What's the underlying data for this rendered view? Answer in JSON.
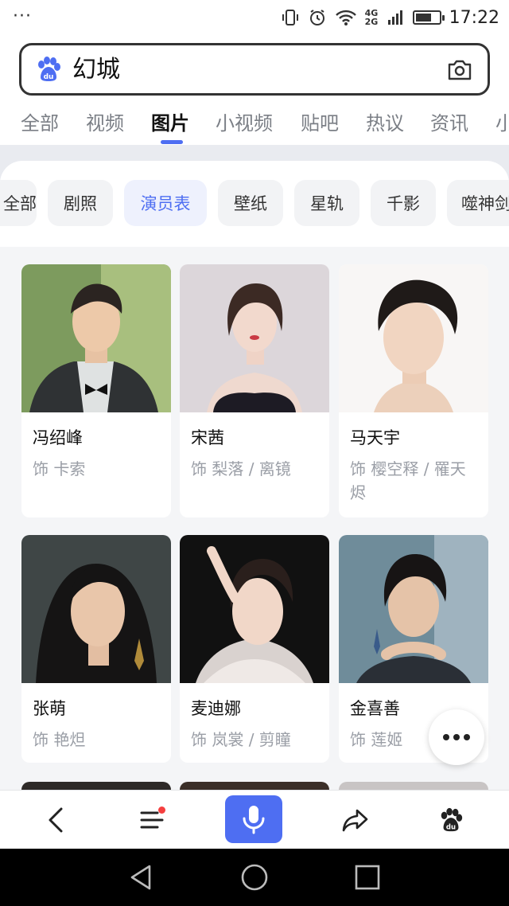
{
  "status_bar": {
    "dots": "···",
    "network": "4G 2G",
    "time": "17:22",
    "battery_level": 0.7
  },
  "search": {
    "query": "幻城",
    "icon_left": "baidu-paw-icon",
    "icon_right": "camera-icon"
  },
  "tabs": [
    {
      "label": "全部",
      "active": false
    },
    {
      "label": "视频",
      "active": false
    },
    {
      "label": "图片",
      "active": true
    },
    {
      "label": "小视频",
      "active": false
    },
    {
      "label": "贴吧",
      "active": false
    },
    {
      "label": "热议",
      "active": false
    },
    {
      "label": "资讯",
      "active": false
    },
    {
      "label": "小",
      "active": false
    }
  ],
  "chips": [
    {
      "label": "全部",
      "active": false
    },
    {
      "label": "剧照",
      "active": false
    },
    {
      "label": "演员表",
      "active": true
    },
    {
      "label": "壁纸",
      "active": false
    },
    {
      "label": "星轨",
      "active": false
    },
    {
      "label": "千影",
      "active": false
    },
    {
      "label": "噬神剑",
      "active": false
    }
  ],
  "cast": [
    {
      "name": "冯绍峰",
      "role": "饰 卡索"
    },
    {
      "name": "宋茜",
      "role": "饰 梨落 / 离镜"
    },
    {
      "name": "马天宇",
      "role": "饰 樱空释 / 罹天烬"
    },
    {
      "name": "张萌",
      "role": "饰 艳炟"
    },
    {
      "name": "麦迪娜",
      "role": "饰 岚裳 / 剪瞳"
    },
    {
      "name": "金喜善",
      "role": "饰 莲姬"
    }
  ],
  "fab": {
    "icon": "more-icon"
  },
  "toolbar": {
    "items": [
      "back-icon",
      "menu-icon",
      "voice-icon",
      "share-icon",
      "baidu-paw-icon"
    ],
    "menu_has_notification": true,
    "accent": "#4e6ef2"
  },
  "nav": {
    "items": [
      "nav-back-icon",
      "nav-home-icon",
      "nav-recent-icon"
    ]
  }
}
